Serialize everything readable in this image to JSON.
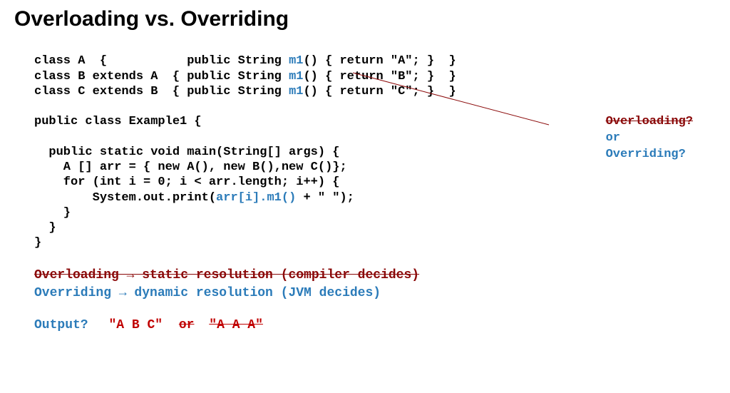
{
  "title": "Overloading vs. Overriding",
  "code": {
    "line1_pre": "class A  {           public String ",
    "line1_method": "m1",
    "line1_post": "() { return \"A\"; }  }",
    "line2_pre": "class B extends A  { public String ",
    "line2_method": "m1",
    "line2_post": "() { return \"B\"; }  }",
    "line3_pre": "class C extends B  { public String ",
    "line3_method": "m1",
    "line3_post": "() { return \"C\"; }  }",
    "blank1": "",
    "line4": "public class Example1 {",
    "blank2": "",
    "line5": "  public static void main(String[] args) {",
    "line6": "    A [] arr = { new A(), new B(),new C()};",
    "line7": "    for (int i = 0; i < arr.length; i++) {",
    "line8_pre": "        System.out.print(",
    "line8_call": "arr[i].m1()",
    "line8_post": " + \" \");",
    "line9": "    }",
    "line10": "  }",
    "line11": "}"
  },
  "annotation": {
    "overloading": "Overloading?",
    "or": "or",
    "overriding": "Overriding?"
  },
  "resolution": {
    "overloading": "Overloading → static resolution  (compiler decides)",
    "overriding": "Overriding  → dynamic resolution (JVM decides)"
  },
  "output": {
    "label": "Output?",
    "answer": "\"A B C\"",
    "or": "or",
    "wrong": "\"A A A\""
  }
}
